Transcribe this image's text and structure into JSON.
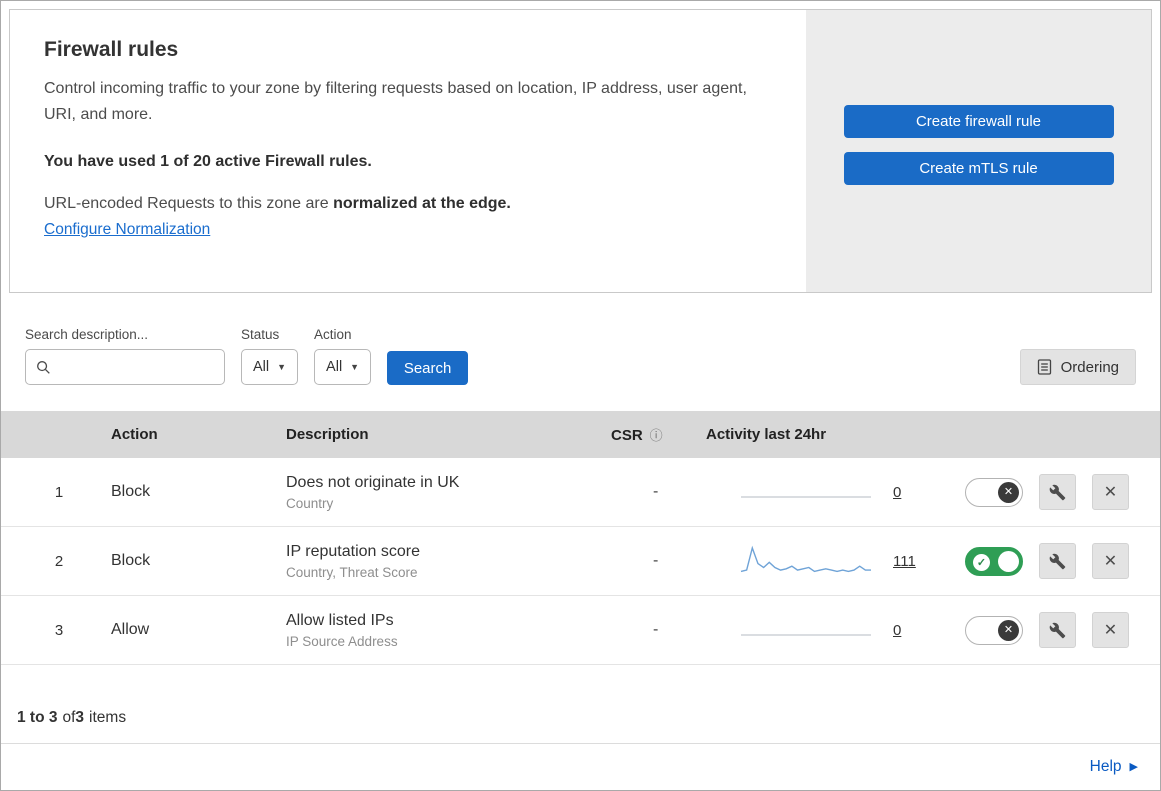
{
  "header": {
    "title": "Firewall rules",
    "description": "Control incoming traffic to your zone by filtering requests based on location, IP address, user agent, URI, and more.",
    "usage": "You have used 1 of 20 active Firewall rules.",
    "normalization_text": "URL-encoded Requests to this zone are ",
    "normalization_bold": "normalized at the edge.",
    "normalization_link": "Configure Normalization",
    "create_firewall_button": "Create firewall rule",
    "create_mtls_button": "Create mTLS rule"
  },
  "filters": {
    "search_label": "Search description...",
    "search_value": "",
    "status_label": "Status",
    "status_value": "All",
    "action_label": "Action",
    "action_value": "All",
    "search_button": "Search",
    "ordering_button": "Ordering"
  },
  "table": {
    "columns": {
      "action": "Action",
      "description": "Description",
      "csr": "CSR",
      "activity": "Activity last 24hr"
    },
    "rows": [
      {
        "index": "1",
        "action": "Block",
        "description": "Does not originate in UK",
        "fields": "Country",
        "csr": "-",
        "activity_count": "0",
        "enabled": false,
        "sparkline": [
          0,
          0,
          0,
          0,
          0,
          0,
          0,
          0,
          0,
          0,
          0,
          0,
          0,
          0,
          0,
          0,
          0,
          0,
          0,
          0,
          0,
          0,
          0,
          0
        ]
      },
      {
        "index": "2",
        "action": "Block",
        "description": "IP reputation score",
        "fields": "Country, Threat Score",
        "csr": "-",
        "activity_count": "111",
        "enabled": true,
        "sparkline": [
          2,
          3,
          20,
          8,
          5,
          9,
          5,
          3,
          4,
          6,
          3,
          4,
          5,
          2,
          3,
          4,
          3,
          2,
          3,
          2,
          3,
          6,
          3,
          3
        ]
      },
      {
        "index": "3",
        "action": "Allow",
        "description": "Allow listed IPs",
        "fields": "IP Source Address",
        "csr": "-",
        "activity_count": "0",
        "enabled": false,
        "sparkline": [
          0,
          0,
          0,
          0,
          0,
          0,
          0,
          0,
          0,
          0,
          0,
          0,
          0,
          0,
          0,
          0,
          0,
          0,
          0,
          0,
          0,
          0,
          0,
          0
        ]
      }
    ]
  },
  "footer": {
    "range": "1 to 3",
    "of": "of",
    "total": "3",
    "items": "items",
    "help": "Help"
  },
  "colors": {
    "primary_blue": "#1a6bc6",
    "link_blue": "#1a6dce",
    "toggle_green": "#2f9e55",
    "sparkline_blue": "#6fa3d7",
    "header_gray": "#d8d8d8"
  }
}
